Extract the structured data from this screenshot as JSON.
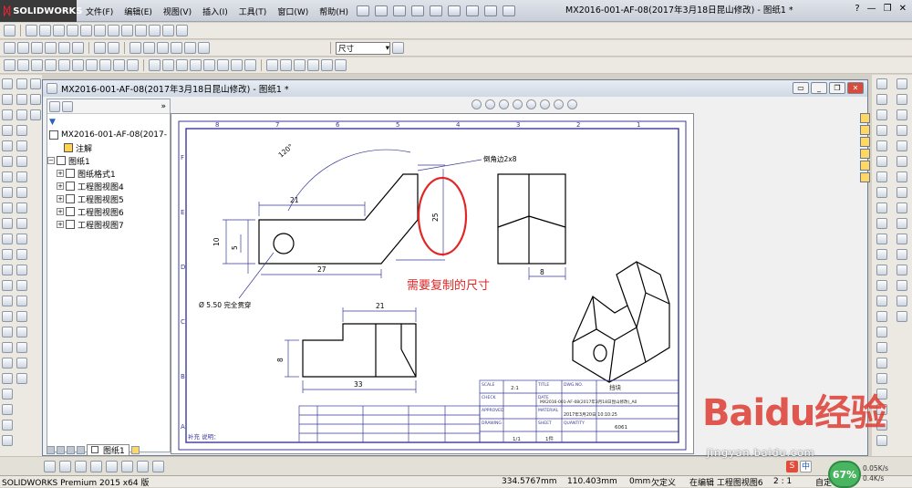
{
  "app": {
    "logo_text": "SOLIDWORKS",
    "title": "MX2016-001-AF-08(2017年3月18日昆山修改) - 图纸1 *",
    "help_label": "?"
  },
  "menu": [
    "文件(F)",
    "编辑(E)",
    "视图(V)",
    "插入(I)",
    "工具(T)",
    "窗口(W)",
    "帮助(H)"
  ],
  "toolbar": {
    "size_dropdown_value": "尺寸"
  },
  "document": {
    "title": "MX2016-001-AF-08(2017年3月18日昆山修改) - 图纸1 *"
  },
  "feature_tree": {
    "root_label": "MX2016-001-AF-08(2017-",
    "items": [
      {
        "label": "注解",
        "level": 1,
        "expand": ""
      },
      {
        "label": "图纸1",
        "level": 1,
        "expand": "−"
      },
      {
        "label": "图纸格式1",
        "level": 2,
        "expand": "+"
      },
      {
        "label": "工程图视图4",
        "level": 2,
        "expand": "+"
      },
      {
        "label": "工程图视图5",
        "level": 2,
        "expand": "+"
      },
      {
        "label": "工程图视图6",
        "level": 2,
        "expand": "+"
      },
      {
        "label": "工程图视图7",
        "level": 2,
        "expand": "+"
      }
    ],
    "sheet_tab": "图纸1"
  },
  "drawing": {
    "border_numbers_top": [
      "8",
      "7",
      "6",
      "5",
      "4",
      "3",
      "2",
      "1"
    ],
    "border_letters_left": [
      "F",
      "E",
      "D",
      "C",
      "B",
      "A"
    ],
    "dim_angle": "120°",
    "dim_21_top": "21",
    "dim_10": "10",
    "dim_5": "5",
    "dim_25": "25",
    "dim_27": "27",
    "dim_8_right": "8",
    "chamfer_note": "倒角边2x8",
    "hole_note": "Ø 5.50 完全贯穿",
    "dim_21_front": "21",
    "dim_8_front": "8",
    "dim_33": "33",
    "annotation_red": "需要复制的尺寸",
    "tb_title": "挡块",
    "tb_scale": "2:1",
    "tb_drawing_no": "MX2016-001-AF-08(2017年3月18日昆山修改)_A0",
    "tb_date": "2017年3月20日 10:10:25",
    "tb_material": "6061",
    "tb_sheet": "1/1",
    "tb_qty": "1件",
    "tb_remark": "补充 说明：",
    "tb_labels": [
      "SCALE",
      "CHECK",
      "APPROVED",
      "DRAWING",
      "DATE",
      "MATERIAL",
      "SHEET",
      "QUANTITY",
      "TITLE",
      "DWG.NO."
    ]
  },
  "statusbar": {
    "product": "SOLIDWORKS Premium 2015 x64 版",
    "x_coord": "334.5767mm",
    "y_coord": "110.403mm",
    "z_coord": "0mm",
    "state": "欠定义",
    "editing": "在编辑 工程图视图6",
    "scale": "2 : 1",
    "custom": "自定"
  },
  "tray": {
    "cpu_percent": "67%",
    "net_up": "0.05K/s",
    "net_down": "0.4K/s",
    "ime_s": "S",
    "ime_zh": "中"
  },
  "watermark": {
    "main": "Baidu经验",
    "sub": "jingyan.baidu.com"
  }
}
